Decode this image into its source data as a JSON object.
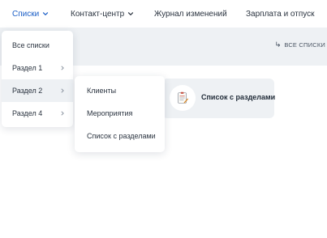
{
  "nav": {
    "items": [
      {
        "label": "Списки",
        "has_dropdown": true,
        "active": true
      },
      {
        "label": "Контакт-центр",
        "has_dropdown": true,
        "active": false
      },
      {
        "label": "Журнал изменений",
        "has_dropdown": false,
        "active": false
      },
      {
        "label": "Зарплата и отпуск",
        "has_dropdown": false,
        "active": false
      }
    ]
  },
  "toolbar": {
    "all_lists_label": "ВСЕ СПИСКИ",
    "all_lists_icon": "back-arrow-icon"
  },
  "card": {
    "title": "Список с разделами",
    "icon": "checklist-icon"
  },
  "dropdown": {
    "items": [
      {
        "label": "Все списки",
        "has_submenu": false
      },
      {
        "label": "Раздел 1",
        "has_submenu": true
      },
      {
        "label": "Раздел 2",
        "has_submenu": true,
        "highlighted": true
      },
      {
        "label": "Раздел 4",
        "has_submenu": true
      }
    ]
  },
  "submenu": {
    "items": [
      {
        "label": "Клиенты"
      },
      {
        "label": "Мероприятия"
      },
      {
        "label": "Список с разделами"
      }
    ]
  },
  "colors": {
    "accent": "#1c5fc7",
    "panel_bg": "#eef1f4",
    "text": "#2b3440"
  }
}
